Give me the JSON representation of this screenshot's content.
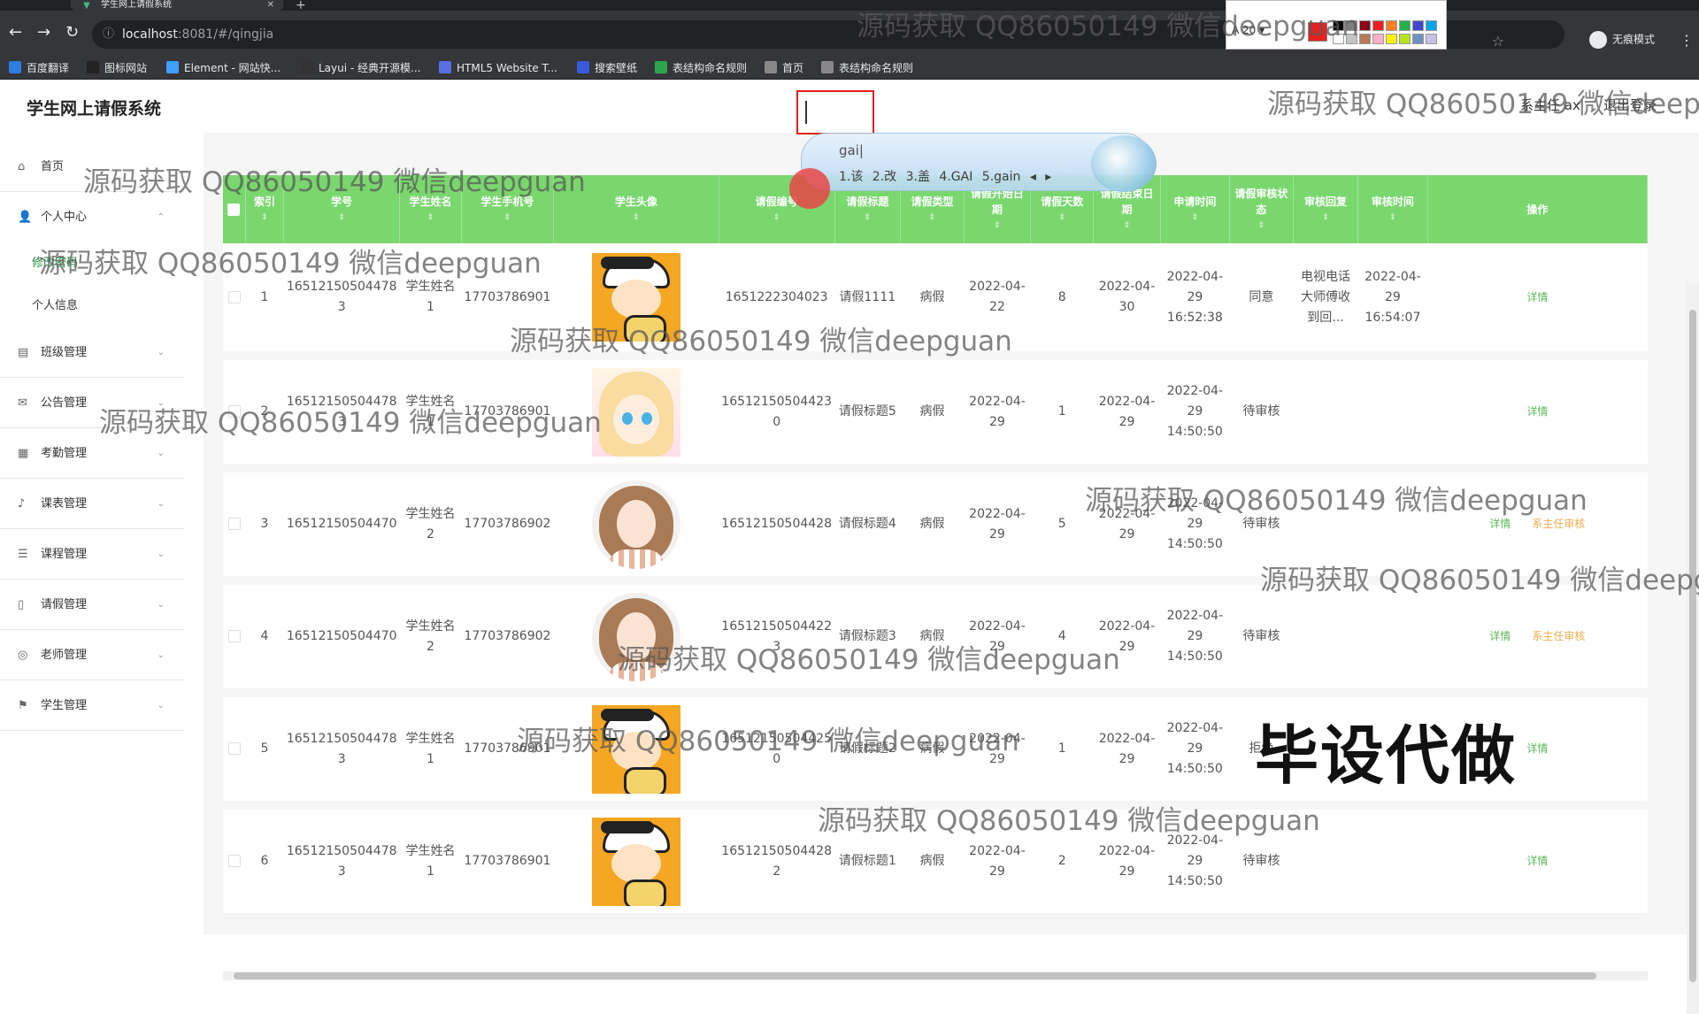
{
  "browser": {
    "tab_title": "学生网上请假系统",
    "url_host": "localhost",
    "url_rest": ":8081/#/qingjia",
    "incognito_label": "无痕模式",
    "bookmarks": [
      {
        "label": "百度翻译",
        "color": "#2f7de1"
      },
      {
        "label": "图标网站",
        "color": "#222222"
      },
      {
        "label": "Element - 网站快...",
        "color": "#409eff"
      },
      {
        "label": "Layui - 经典开源模...",
        "color": "#333333"
      },
      {
        "label": "HTML5 Website T...",
        "color": "#5b6ee1"
      },
      {
        "label": "搜索壁纸",
        "color": "#3a5bd9"
      },
      {
        "label": "表结构命名规则",
        "color": "#2ea44f"
      },
      {
        "label": "首页",
        "color": "#888888"
      },
      {
        "label": "表结构命名规则",
        "color": "#888888"
      }
    ]
  },
  "paint_toolbar": {
    "size": "20",
    "current_color": "#e8201f"
  },
  "app": {
    "title": "学生网上请假系统",
    "top_user": "系主任 ax",
    "logout": "退出登录"
  },
  "sidebar": {
    "items": [
      {
        "label": "首页",
        "icon": "home-icon",
        "glyph": "⌂",
        "chevron": ""
      },
      {
        "label": "个人中心",
        "icon": "user-icon",
        "glyph": "👤",
        "chevron": "⌃"
      },
      {
        "label": "修改密码",
        "sub": true
      },
      {
        "label": "个人信息",
        "sub": true
      },
      {
        "label": "班级管理",
        "icon": "class-icon",
        "glyph": "▤",
        "chevron": "⌄"
      },
      {
        "label": "公告管理",
        "icon": "mail-icon",
        "glyph": "✉",
        "chevron": "⌄"
      },
      {
        "label": "考勤管理",
        "icon": "briefcase-icon",
        "glyph": "▦",
        "chevron": "⌄"
      },
      {
        "label": "课表管理",
        "icon": "mic-icon",
        "glyph": "♪",
        "chevron": "⌄"
      },
      {
        "label": "课程管理",
        "icon": "list-icon",
        "glyph": "☰",
        "chevron": "⌄"
      },
      {
        "label": "请假管理",
        "icon": "phone-icon",
        "glyph": "▯",
        "chevron": "⌄"
      },
      {
        "label": "老师管理",
        "icon": "globe-icon",
        "glyph": "◎",
        "chevron": "⌄"
      },
      {
        "label": "学生管理",
        "icon": "flag-icon",
        "glyph": "⚑",
        "chevron": "⌄"
      }
    ]
  },
  "table": {
    "columns": [
      "",
      "索引",
      "学号",
      "学生姓名",
      "学生手机号",
      "学生头像",
      "请假编号",
      "请假标题",
      "请假类型",
      "请假开始日期",
      "请假天数",
      "请假结束日期",
      "申请时间",
      "请假审核状态",
      "审核回复",
      "审核时间",
      "操作"
    ],
    "rows": [
      {
        "idx": "1",
        "xuehao": "16512150504478 3",
        "name": "学生姓名1",
        "phone": "17703786901",
        "avatar": "boy",
        "no": "1651222304023",
        "title": "请假1111",
        "type": "病假",
        "start": "2022-04-22",
        "days": "8",
        "end": "2022-04-30",
        "apply": "2022-04-29 16:52:38",
        "status": "同意",
        "reply": "电视电话大师傅收到回...",
        "audit_time": "2022-04-29 16:54:07",
        "has_audit": false
      },
      {
        "idx": "2",
        "xuehao": "16512150504478 3",
        "name": "学生姓名1",
        "phone": "17703786901",
        "avatar": "anime",
        "no": "16512150504423 0",
        "title": "请假标题5",
        "type": "病假",
        "start": "2022-04-29",
        "days": "1",
        "end": "2022-04-29",
        "apply": "2022-04-29 14:50:50",
        "status": "待审核",
        "reply": "",
        "audit_time": "",
        "has_audit": false
      },
      {
        "idx": "3",
        "xuehao": "16512150504470",
        "name": "学生姓名2",
        "phone": "17703786902",
        "avatar": "girl",
        "no": "16512150504428",
        "title": "请假标题4",
        "type": "病假",
        "start": "2022-04-29",
        "days": "5",
        "end": "2022-04-29",
        "apply": "2022-04-29 14:50:50",
        "status": "待审核",
        "reply": "",
        "audit_time": "",
        "has_audit": true
      },
      {
        "idx": "4",
        "xuehao": "16512150504470",
        "name": "学生姓名2",
        "phone": "17703786902",
        "avatar": "girl",
        "no": "16512150504422 3",
        "title": "请假标题3",
        "type": "病假",
        "start": "2022-04-29",
        "days": "4",
        "end": "2022-04-29",
        "apply": "2022-04-29 14:50:50",
        "status": "待审核",
        "reply": "",
        "audit_time": "",
        "has_audit": true
      },
      {
        "idx": "5",
        "xuehao": "16512150504478 3",
        "name": "学生姓名1",
        "phone": "17703786901",
        "avatar": "boy",
        "no": "16512150504425 0",
        "title": "请假标题2",
        "type": "病假",
        "start": "2022-04-29",
        "days": "1",
        "end": "2022-04-29",
        "apply": "2022-04-29 14:50:50",
        "status": "拒绝",
        "reply": "",
        "audit_time": "",
        "has_audit": false
      },
      {
        "idx": "6",
        "xuehao": "16512150504478 3",
        "name": "学生姓名1",
        "phone": "17703786901",
        "avatar": "boy",
        "no": "16512150504428 2",
        "title": "请假标题1",
        "type": "病假",
        "start": "2022-04-29",
        "days": "2",
        "end": "2022-04-29",
        "apply": "2022-04-29 14:50:50",
        "status": "待审核",
        "reply": "",
        "audit_time": "",
        "has_audit": false
      }
    ],
    "detail_label": "详情",
    "audit_label": "系主任审核"
  },
  "ime": {
    "composition": "gai|",
    "candidates": "1.该  2.改  3.盖  4.GAI  5.gain  ◂ ▸"
  },
  "watermark": "源码获取 QQ86050149 微信deepguan",
  "big_mark": "毕设代做"
}
